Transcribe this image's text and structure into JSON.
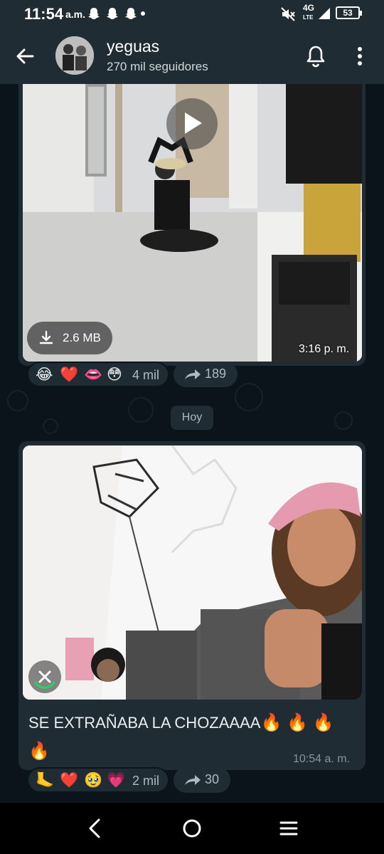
{
  "status_bar": {
    "time": "11:54",
    "ampm": "a.m.",
    "network": "4G",
    "network_sub": "LTE",
    "battery": "53",
    "notification_icons": [
      "snapchat-ghost-icon",
      "snapchat-ghost-icon",
      "snapchat-ghost-icon"
    ]
  },
  "header": {
    "title": "yeguas",
    "subtitle": "270 mil seguidores"
  },
  "messages": [
    {
      "type": "video",
      "download_size": "2.6 MB",
      "time": "3:16 p. m.",
      "reactions": {
        "emojis": [
          "😂",
          "❤️",
          "👄",
          "😳"
        ],
        "count": "4 mil"
      },
      "forwards": "189"
    },
    {
      "type": "image",
      "caption_text": "SE EXTRAÑABA LA CHOZAAAA",
      "caption_emojis": "🔥 🔥 🔥",
      "caption_emoji_last": "🔥",
      "time": "10:54 a. m.",
      "reactions": {
        "emojis": [
          "🦶",
          "❤️",
          "🥹",
          "💗"
        ],
        "count": "2 mil"
      },
      "forwards": "30"
    }
  ],
  "date_chip": "Hoy",
  "colors": {
    "background": "#0b141a",
    "bar": "#1f2c34",
    "bubble": "#1f2c34",
    "secondary_text": "#8696a0"
  }
}
